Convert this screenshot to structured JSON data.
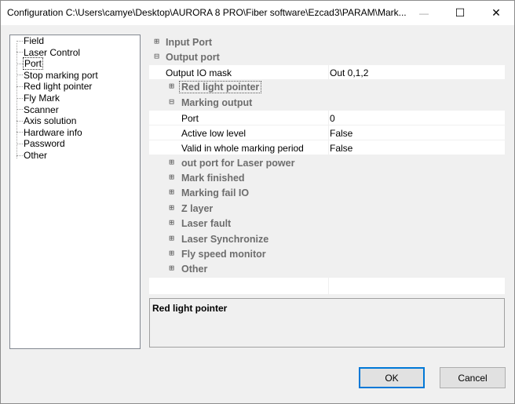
{
  "window": {
    "title": "Configuration C:\\Users\\camye\\Desktop\\AURORA 8 PRO\\Fiber software\\Ezcad3\\PARAM\\Mark...",
    "minimize_glyph": "—",
    "maximize_glyph": "☐",
    "close_glyph": "✕"
  },
  "tree": {
    "items": [
      {
        "label": "Field"
      },
      {
        "label": "Laser Control"
      },
      {
        "label": "Port",
        "selected": true
      },
      {
        "label": "Stop marking port"
      },
      {
        "label": "Red light pointer"
      },
      {
        "label": "Fly Mark"
      },
      {
        "label": "Scanner"
      },
      {
        "label": "Axis solution"
      },
      {
        "label": "Hardware info"
      },
      {
        "label": "Password"
      },
      {
        "label": "Other"
      }
    ]
  },
  "grid": {
    "input_port": {
      "label": "Input Port",
      "expander": "⊞"
    },
    "output_port": {
      "label": "Output port",
      "expander": "⊟"
    },
    "output_io_mask": {
      "name": "Output IO mask",
      "value": "Out 0,1,2"
    },
    "red_light_pointer": {
      "label": "Red light pointer",
      "expander": "⊞"
    },
    "marking_output": {
      "label": "Marking output",
      "expander": "⊟"
    },
    "port": {
      "name": "Port",
      "value": "0"
    },
    "active_low_level": {
      "name": "Active low level",
      "value": "False"
    },
    "valid_whole_period": {
      "name": "Valid in whole marking period",
      "value": "False"
    },
    "categories": [
      {
        "label": "out port for Laser power",
        "expander": "⊞"
      },
      {
        "label": "Mark finished",
        "expander": "⊞"
      },
      {
        "label": "Marking fail IO",
        "expander": "⊞"
      },
      {
        "label": "Z layer",
        "expander": "⊞"
      },
      {
        "label": "Laser fault",
        "expander": "⊞"
      },
      {
        "label": "Laser Synchronize",
        "expander": "⊞"
      },
      {
        "label": "Fly speed monitor",
        "expander": "⊞"
      },
      {
        "label": "Other",
        "expander": "⊞"
      }
    ]
  },
  "description": {
    "title": "Red light pointer"
  },
  "buttons": {
    "ok": "OK",
    "cancel": "Cancel"
  }
}
